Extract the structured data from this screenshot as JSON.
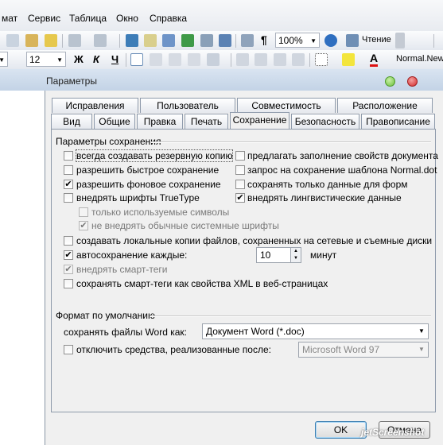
{
  "menubar": {
    "items": [
      "мат",
      "Сервис",
      "Таблица",
      "Окно",
      "Справка"
    ]
  },
  "toolbar1": {
    "zoom": "100%",
    "reading_label": "Чтение"
  },
  "toolbar2": {
    "font_size": "12",
    "bold": "Ж",
    "italic": "К",
    "underline": "Ч",
    "style_name": "Normal.New"
  },
  "dialog": {
    "title": "Параметры",
    "tabs_row1": [
      "Исправления",
      "Пользователь",
      "Совместимость",
      "Расположение"
    ],
    "tabs_row2": [
      "Вид",
      "Общие",
      "Правка",
      "Печать",
      "Сохранение",
      "Безопасность",
      "Правописание"
    ],
    "active_tab": "Сохранение",
    "save_group_title": "Параметры сохранения",
    "options_left": [
      {
        "label": "всегда создавать резервную копию",
        "checked": false
      },
      {
        "label": "разрешить быстрое сохранение",
        "checked": false
      },
      {
        "label": "разрешить фоновое сохранение",
        "checked": true
      },
      {
        "label": "внедрять шрифты TrueType",
        "checked": false
      }
    ],
    "options_right": [
      {
        "label": "предлагать заполнение свойств документа",
        "checked": false
      },
      {
        "label": "запрос на сохранение шаблона Normal.dot",
        "checked": false
      },
      {
        "label": "сохранять только данные для форм",
        "checked": false
      },
      {
        "label": "внедрять лингвистические данные",
        "checked": true
      }
    ],
    "sub_options": [
      {
        "label": "только используемые символы",
        "checked": false
      },
      {
        "label": "не внедрять обычные системные шрифты",
        "checked": true
      }
    ],
    "local_copies": {
      "label": "создавать локальные копии файлов, сохраненных на сетевые и съемные диски",
      "checked": false
    },
    "autosave": {
      "label": "автосохранение каждые:",
      "checked": true,
      "value": "10",
      "unit": "минут"
    },
    "smart_tags": {
      "label": "внедрять смарт-теги",
      "checked": true
    },
    "smart_tags_xml": {
      "label": "сохранять смарт-теги как свойства XML в веб-страницах",
      "checked": false
    },
    "default_group_title": "Формат по умолчанию",
    "save_as_label": "сохранять файлы Word как:",
    "save_as_value": "Документ Word (*.doc)",
    "disable_label": "отключить средства, реализованные после:",
    "disable_checked": false,
    "disable_value": "Microsoft Word 97",
    "ok": "OK",
    "cancel": "Отмена"
  },
  "watermark": "jetScreenshot"
}
